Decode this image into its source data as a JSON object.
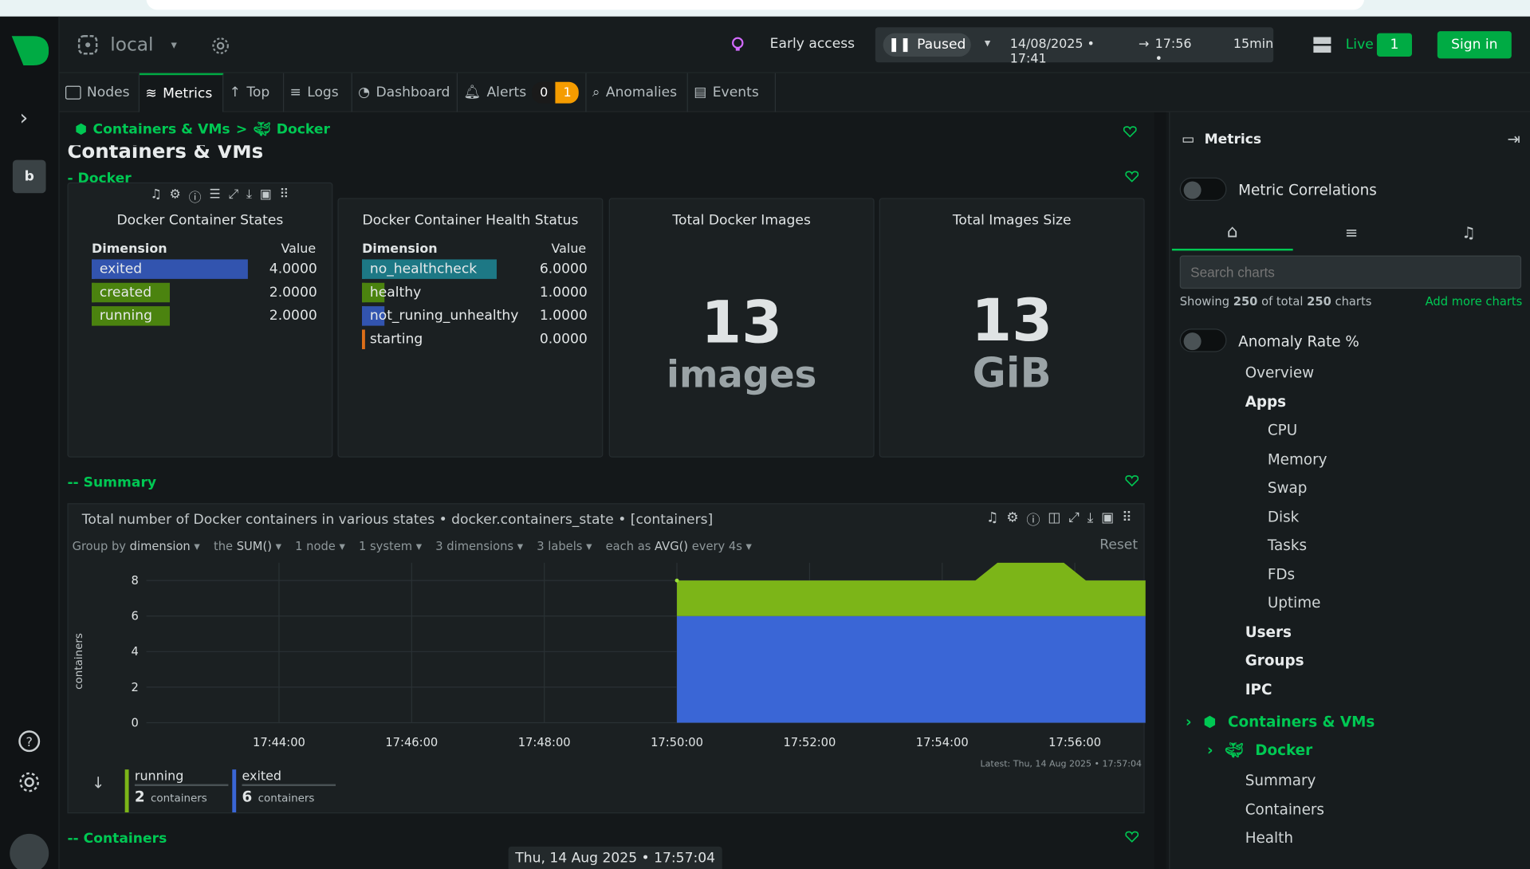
{
  "sidebar": {
    "space_initial": "b"
  },
  "topbar": {
    "room": "local",
    "early_access": "Early access",
    "paused": "Paused",
    "date_range": "14/08/2025 • 17:41",
    "date_to": "17:56 •",
    "duration": "15min",
    "live_label": "Live",
    "live_count": "1",
    "sign_in": "Sign in"
  },
  "tabs": [
    {
      "label": "Nodes"
    },
    {
      "label": "Metrics"
    },
    {
      "label": "Top"
    },
    {
      "label": "Logs"
    },
    {
      "label": "Dashboard"
    },
    {
      "label": "Alerts"
    },
    {
      "label": "Anomalies"
    },
    {
      "label": "Events"
    }
  ],
  "alerts": {
    "critical": "0",
    "warning": "1"
  },
  "breadcrumb": {
    "parent": "Containers & VMs",
    "sep": ">",
    "child": "Docker"
  },
  "page_title": "Containers & VMs",
  "section_docker": "- Docker",
  "section_summary": "-- Summary",
  "section_containers": "-- Containers",
  "cards": {
    "states": {
      "title": "Docker Container States",
      "dim_header": "Dimension",
      "val_header": "Value",
      "rows": [
        {
          "name": "exited",
          "value": "4.0000",
          "color": "#3558b8",
          "frac": 1.0
        },
        {
          "name": "created",
          "value": "2.0000",
          "color": "#4f8a10",
          "frac": 0.5
        },
        {
          "name": "running",
          "value": "2.0000",
          "color": "#4f8a10",
          "frac": 0.5
        }
      ]
    },
    "health": {
      "title": "Docker Container Health Status",
      "dim_header": "Dimension",
      "val_header": "Value",
      "rows": [
        {
          "name": "no_healthcheck",
          "value": "6.0000",
          "color": "#1e7e8c",
          "frac": 1.0
        },
        {
          "name": "healthy",
          "value": "1.0000",
          "color": "#4f8a10",
          "frac": 0.17
        },
        {
          "name": "not_runing_unhealthy",
          "value": "1.0000",
          "color": "#3558b8",
          "frac": 0.17
        },
        {
          "name": "starting",
          "value": "0.0000",
          "color": "#e8741a",
          "frac": 0
        }
      ]
    },
    "images": {
      "title": "Total Docker Images",
      "value": "13",
      "unit": "images"
    },
    "size": {
      "title": "Total Images Size",
      "value": "13",
      "unit": "GiB"
    }
  },
  "summary_chart": {
    "title": "Total number of Docker containers in various states • docker.containers_state • [containers]",
    "controls": {
      "group_by": "Group by",
      "group_val": "dimension",
      "agg": "the",
      "agg_val": "SUM()",
      "nodes": "1 node",
      "systems": "1 system",
      "dims": "3 dimensions",
      "labels": "3 labels",
      "each": "each as",
      "each_val": "AVG()",
      "every": "every 4s",
      "reset": "Reset"
    },
    "ylabel": "containers",
    "latest": "Latest: Thu, 14 Aug 2025 • 17:57:04",
    "legend": [
      {
        "name": "running",
        "value": "2",
        "unit": "containers",
        "color": "#7cb518"
      },
      {
        "name": "exited",
        "value": "6",
        "unit": "containers",
        "color": "#3a66d6"
      }
    ]
  },
  "chart_data": {
    "type": "area",
    "title": "Total number of Docker containers in various states • docker.containers_state • [containers]",
    "xlabel": "",
    "ylabel": "containers",
    "ylim": [
      0,
      9
    ],
    "x_ticks": [
      "17:44:00",
      "17:46:00",
      "17:48:00",
      "17:50:00",
      "17:52:00",
      "17:54:00",
      "17:56:00"
    ],
    "y_ticks": [
      0,
      2,
      4,
      6,
      8
    ],
    "x": [
      "17:50:00",
      "17:50:04",
      "17:52:30",
      "17:54:30",
      "17:54:50",
      "17:55:50",
      "17:56:10",
      "17:57:04"
    ],
    "series": [
      {
        "name": "exited",
        "color": "#3a66d6",
        "values": [
          6,
          6,
          6,
          6,
          6,
          6,
          6,
          6
        ]
      },
      {
        "name": "running",
        "color": "#7cb518",
        "values": [
          2,
          2,
          2,
          2,
          3,
          3,
          2,
          2
        ]
      }
    ],
    "stacked": true
  },
  "datebar": "Thu, 14 Aug 2025 • 17:57:04",
  "right_panel": {
    "title": "Metrics",
    "metric_correlations": "Metric Correlations",
    "search_placeholder": "Search charts",
    "showing_prefix": "Showing",
    "showing_count": "250",
    "showing_mid": "of total",
    "showing_total": "250",
    "showing_suffix": "charts",
    "add_more": "Add more charts",
    "anomaly_rate": "Anomaly Rate %",
    "menu": [
      "Overview",
      "Apps",
      "CPU",
      "Memory",
      "Swap",
      "Disk",
      "Tasks",
      "FDs",
      "Uptime",
      "Users",
      "Groups",
      "IPC"
    ],
    "tree_containers": "Containers & VMs",
    "tree_docker": "Docker",
    "docker_sub": [
      "Summary",
      "Containers",
      "Health"
    ]
  }
}
